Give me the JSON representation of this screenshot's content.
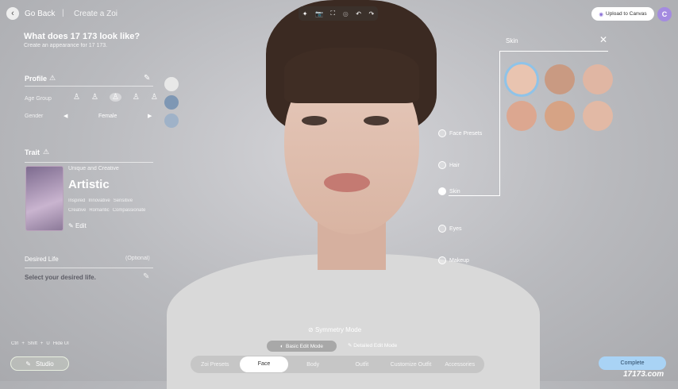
{
  "nav": {
    "back": "Go Back",
    "section": "Create a Zoi"
  },
  "header": {
    "title": "What does 17 173 look like?",
    "subtitle": "Create an appearance for 17 173."
  },
  "profile": {
    "title": "Profile",
    "age_label": "Age Group",
    "gender_label": "Gender",
    "gender_value": "Female"
  },
  "trait": {
    "title": "Trait",
    "category": "Unique and Creative",
    "name": "Artistic",
    "tags": [
      "Inspired",
      "Innovative",
      "Sensitive",
      "Creative",
      "Romantic",
      "Compassionate"
    ],
    "edit": "Edit"
  },
  "desired": {
    "title": "Desired Life",
    "optional": "(Optional)",
    "prompt": "Select your desired life."
  },
  "top": {
    "upload": "Upload to Canvas",
    "avatar": "C"
  },
  "menu": [
    "Face Presets",
    "Hair",
    "Skin",
    "Eyes",
    "Makeup"
  ],
  "skin_panel": {
    "title": "Skin",
    "colors": [
      "#e9c4b0",
      "#c99a82",
      "#e0b6a3",
      "#dca790",
      "#d6a385",
      "#e2b9a5"
    ]
  },
  "symmetry": "Symmetry Mode",
  "modes": {
    "basic": "Basic Edit Mode",
    "detailed": "Detailed Edit Mode"
  },
  "tabs": [
    "Zoi Presets",
    "Face",
    "Body",
    "Outfit",
    "Customize Outfit",
    "Accessories"
  ],
  "shortcut": {
    "keys": [
      "Ctrl",
      "Shift",
      "U"
    ],
    "label": "Hide UI"
  },
  "studio": "Studio",
  "complete": "Complete",
  "watermark": "17173.com"
}
